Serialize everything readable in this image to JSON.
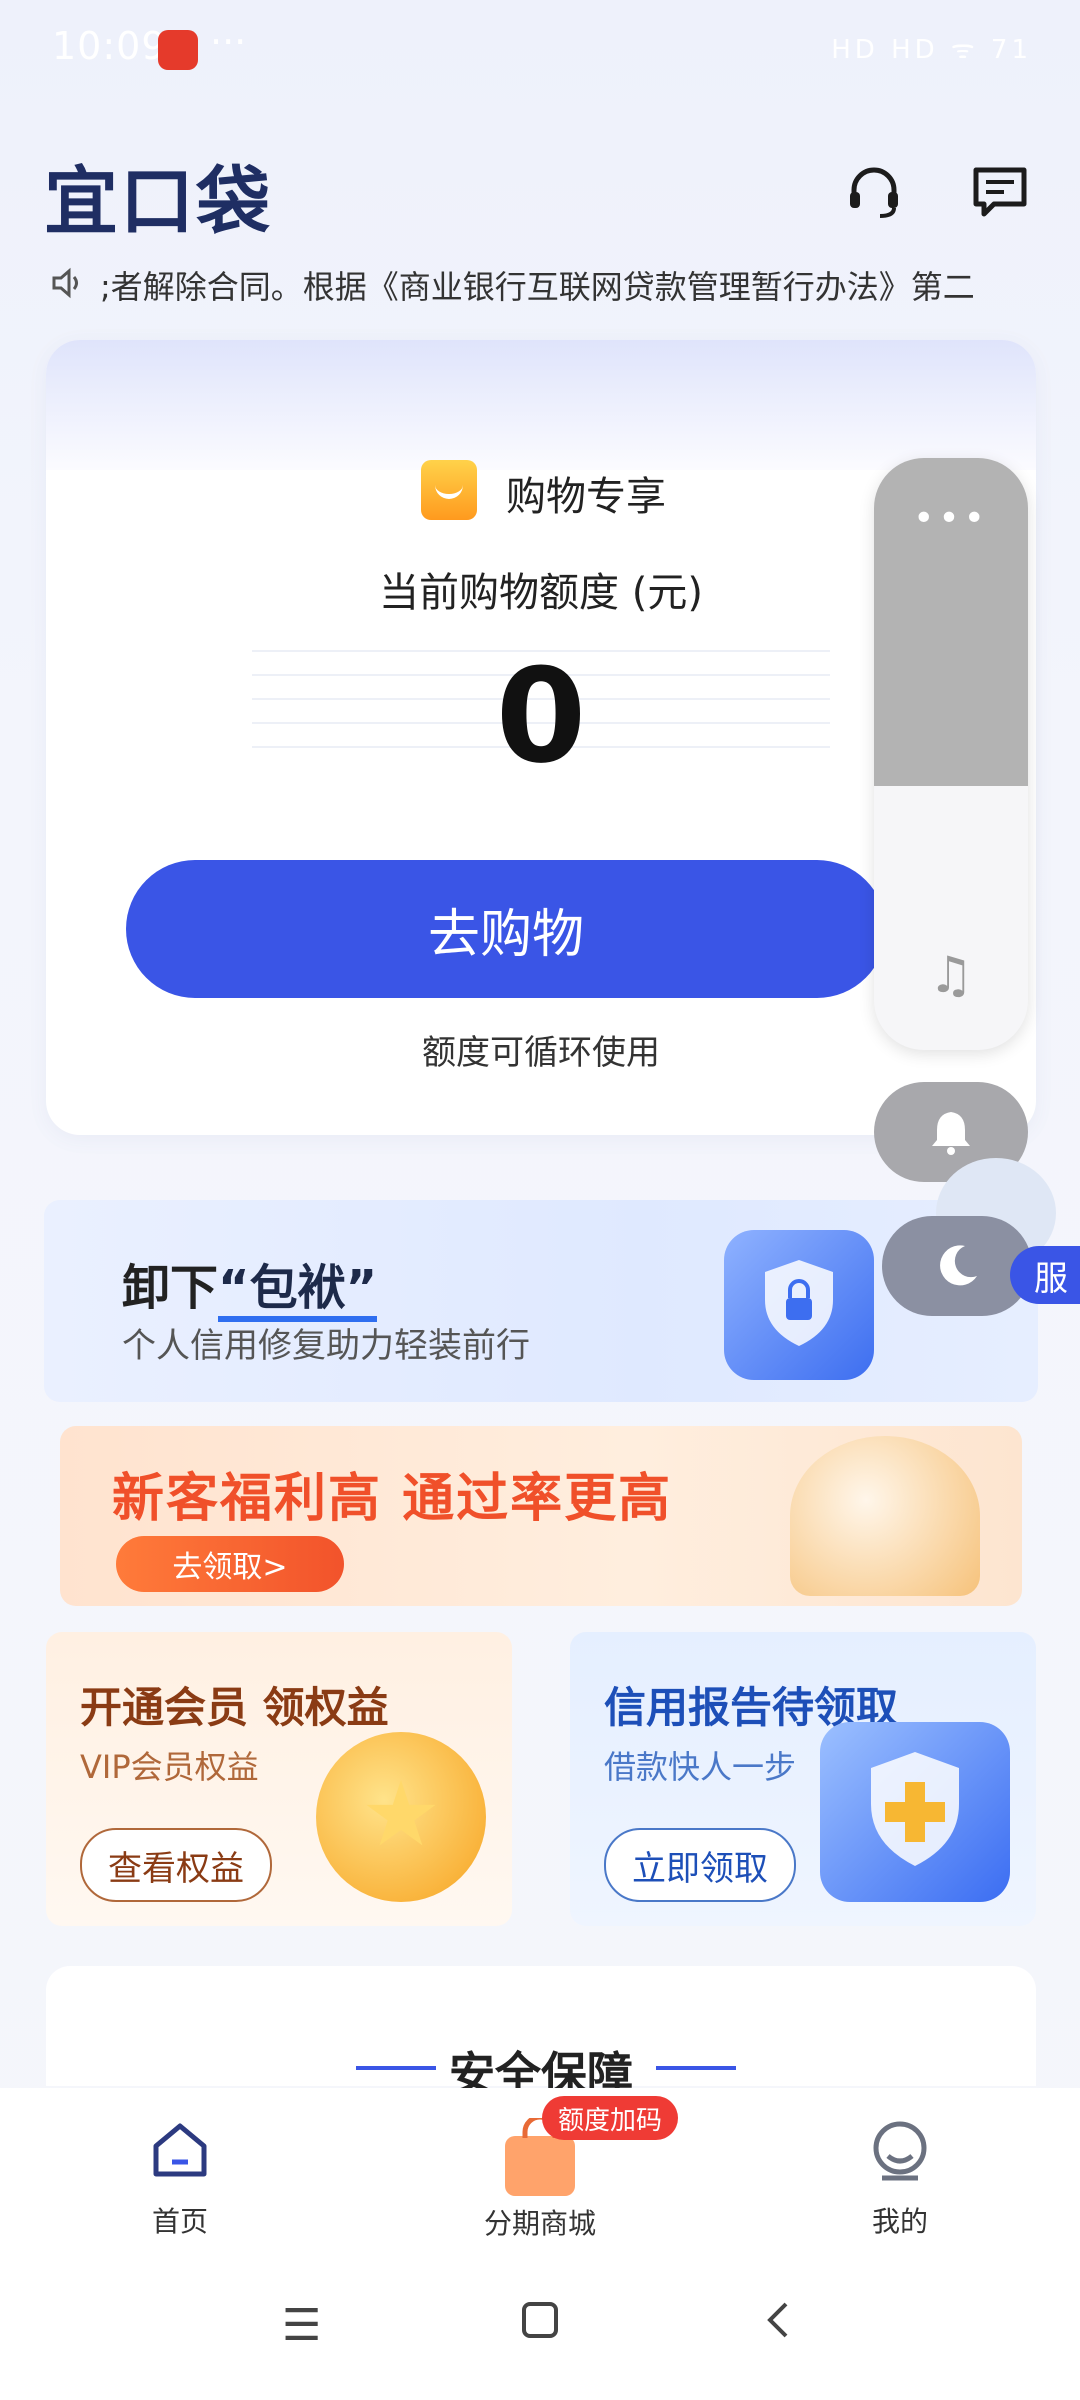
{
  "status_bar": {
    "time": "10:09",
    "more": "···",
    "right_icons": "HD HD ᯤ 71"
  },
  "header": {
    "logo": "宜口袋",
    "support_icon": "headset-icon",
    "message_icon": "message-icon"
  },
  "notice": {
    "icon": "speaker-icon",
    "text": ";者解除合同。根据《商业银行互联网贷款管理暂行办法》第二"
  },
  "credit_card": {
    "tag_label": "购物专享",
    "title": "当前购物额度 (元)",
    "amount": "0",
    "button_label": "去购物",
    "note": "额度可循环使用"
  },
  "floating_controls": {
    "menu_dots": "•••",
    "music_icon": "♫",
    "bell_icon": "bell-icon",
    "moon_icon": "moon-icon",
    "service_tab": "服"
  },
  "banner_repair": {
    "title_prefix": "卸下",
    "title_highlight": "“包袱”",
    "subtitle": "个人信用修复助力轻装前行"
  },
  "banner_newcustomer": {
    "title": "新客福利高 通过率更高",
    "button_label": "去领取>"
  },
  "member_card": {
    "title": "开通会员 领权益",
    "subtitle": "VIP会员权益",
    "button_label": "查看权益"
  },
  "report_card": {
    "title": "信用报告待领取",
    "subtitle": "借款快人一步",
    "button_label": "立即领取"
  },
  "safety": {
    "title": "安全保障"
  },
  "bottom_nav": {
    "items": [
      {
        "label": "首页",
        "icon": "home-icon"
      },
      {
        "label": "分期商城",
        "icon": "shopping-bag-icon"
      },
      {
        "label": "我的",
        "icon": "profile-icon"
      }
    ],
    "badge": "额度加码"
  },
  "colors": {
    "primary": "#3a55e6",
    "orange": "#f0502a",
    "logo": "#1f2e63"
  }
}
